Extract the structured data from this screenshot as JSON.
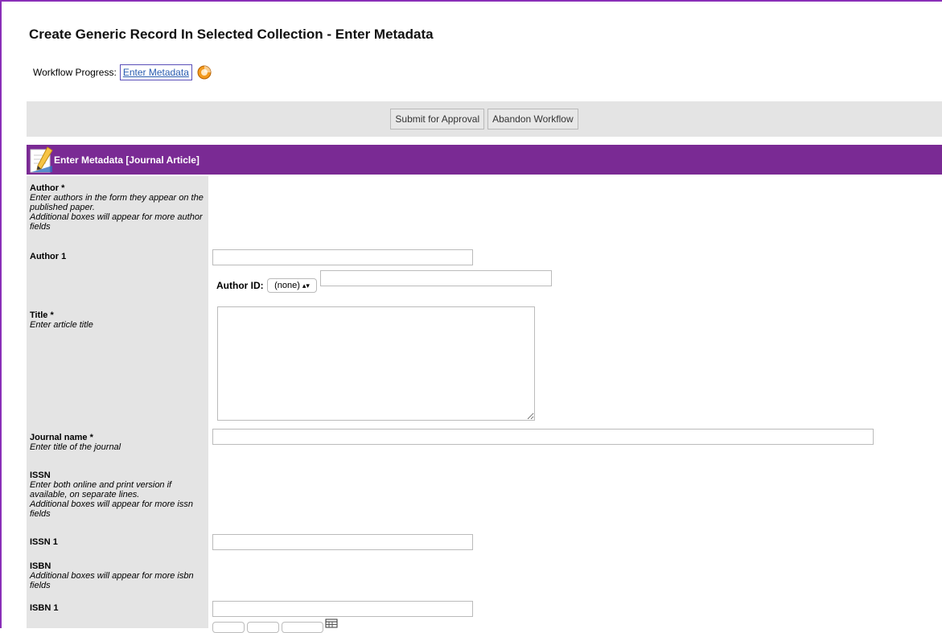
{
  "page": {
    "title": "Create Generic Record In Selected Collection - Enter Metadata"
  },
  "workflow": {
    "label": "Workflow Progress:",
    "step": "Enter Metadata"
  },
  "toolbar": {
    "submit_label": "Submit for Approval",
    "abandon_label": "Abandon Workflow"
  },
  "section": {
    "title": "Enter Metadata [Journal Article]"
  },
  "fields": {
    "author": {
      "label": "Author *",
      "help": [
        "Enter authors in the form they appear on the published paper.",
        "Additional boxes will appear for more author fields"
      ],
      "author1_label": "Author 1",
      "author1_value": "",
      "author_id_label": "Author ID:",
      "author_id_selected": "(none)",
      "author_id_value": ""
    },
    "title": {
      "label": "Title *",
      "help": "Enter article title",
      "value": ""
    },
    "journal": {
      "label": "Journal name *",
      "help": "Enter title of the journal",
      "value": ""
    },
    "issn": {
      "label": "ISSN",
      "help": [
        "Enter both online and print version if available, on separate lines.",
        "Additional boxes will appear for more issn fields"
      ],
      "issn1_label": "ISSN 1",
      "issn1_value": ""
    },
    "isbn": {
      "label": "ISBN",
      "help": "Additional boxes will appear for more isbn fields",
      "isbn1_label": "ISBN 1",
      "isbn1_value": ""
    }
  },
  "colors": {
    "accent": "#7a2a94",
    "frame": "#8a2fb8",
    "panel": "#e4e4e4",
    "link": "#2a5db0"
  },
  "icons": [
    "progress-bullet-icon",
    "pencil-icon",
    "chevron-updown-icon",
    "calendar-icon"
  ]
}
